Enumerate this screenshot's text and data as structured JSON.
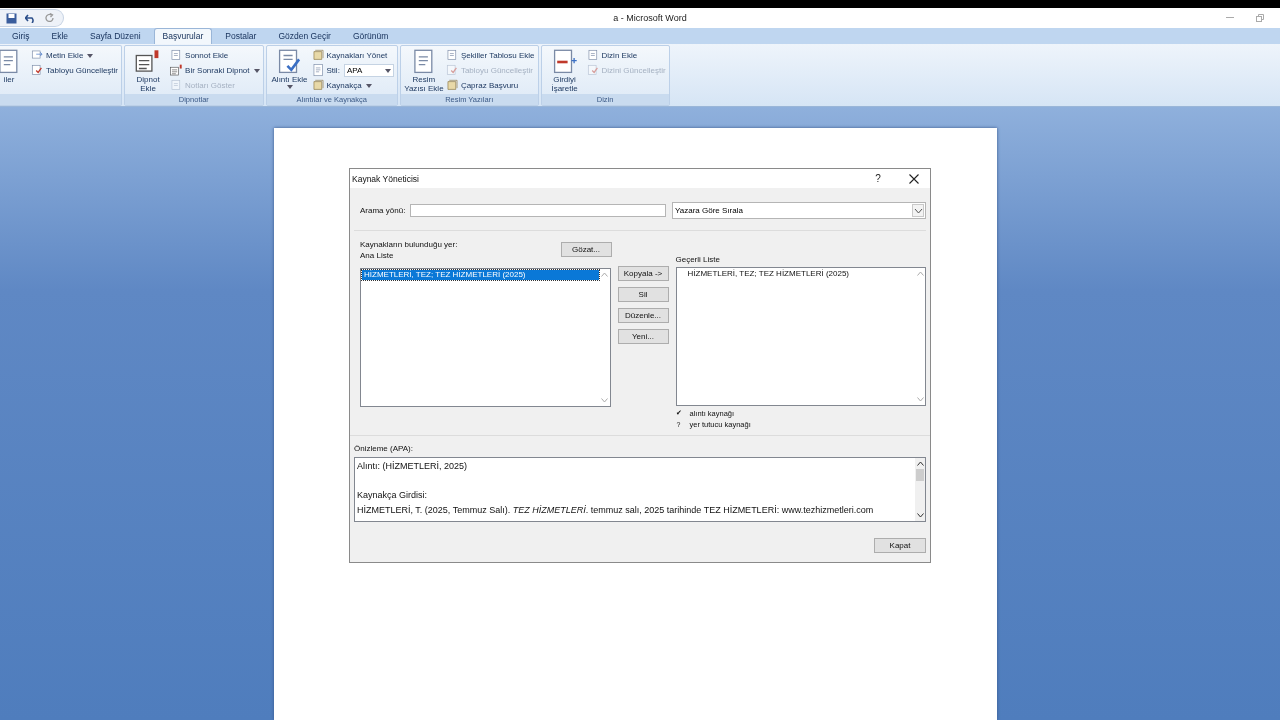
{
  "window": {
    "title": "a - Microsoft Word"
  },
  "tabs": [
    {
      "label": "Giriş",
      "selected": false
    },
    {
      "label": "Ekle",
      "selected": false
    },
    {
      "label": "Sayfa Düzeni",
      "selected": false
    },
    {
      "label": "Başvurular",
      "selected": true
    },
    {
      "label": "Postalar",
      "selected": false
    },
    {
      "label": "Gözden Geçir",
      "selected": false
    },
    {
      "label": "Görünüm",
      "selected": false
    }
  ],
  "ribbon_groups": [
    {
      "items": [
        {
          "kind": "large",
          "label": "iler",
          "dropdown": false,
          "disabled": false
        },
        {
          "kind": "small",
          "label": "Metin Ekle",
          "dropdown": true,
          "disabled": false
        },
        {
          "kind": "small",
          "label": "Tabloyu Güncelleştir",
          "dropdown": false,
          "disabled": false
        }
      ]
    },
    {
      "label": "Dipnotlar",
      "items": [
        {
          "kind": "large",
          "label": "Dipnot Ekle",
          "dropdown": false,
          "disabled": false
        },
        {
          "kind": "small",
          "label": "Sonnot Ekle",
          "dropdown": false,
          "disabled": false
        },
        {
          "kind": "small",
          "label": "Bir Sonraki Dipnot",
          "dropdown": true,
          "disabled": false
        },
        {
          "kind": "small",
          "label": "Notları Göster",
          "dropdown": false,
          "disabled": true
        }
      ]
    },
    {
      "label": "Alıntılar ve Kaynakça",
      "items": [
        {
          "kind": "large",
          "label": "Alıntı Ekle",
          "dropdown": true,
          "disabled": false
        },
        {
          "kind": "small",
          "label": "Kaynakları Yönet",
          "dropdown": false,
          "disabled": false
        },
        {
          "kind": "style",
          "label": "Stil:",
          "value": "APA",
          "dropdown": true,
          "disabled": false
        },
        {
          "kind": "small",
          "label": "Kaynakça",
          "dropdown": true,
          "disabled": false
        }
      ]
    },
    {
      "label": "Resim Yazıları",
      "items": [
        {
          "kind": "large",
          "label": "Resim Yazısı Ekle",
          "dropdown": false,
          "disabled": false
        },
        {
          "kind": "small",
          "label": "Şekiller Tablosu Ekle",
          "dropdown": false,
          "disabled": false
        },
        {
          "kind": "small",
          "label": "Tabloyu Güncelleştir",
          "dropdown": false,
          "disabled": true
        },
        {
          "kind": "small",
          "label": "Çapraz Başvuru",
          "dropdown": false,
          "disabled": false
        }
      ]
    },
    {
      "label": "Dizin",
      "items": [
        {
          "kind": "large",
          "label": "Girdiyi İşaretle",
          "dropdown": false,
          "disabled": false
        },
        {
          "kind": "small",
          "label": "Dizin Ekle",
          "dropdown": false,
          "disabled": false
        },
        {
          "kind": "small",
          "label": "Dizini Güncelleştir",
          "dropdown": false,
          "disabled": true
        }
      ]
    }
  ],
  "dialog": {
    "title": "Kaynak Yöneticisi",
    "help": "?",
    "search": {
      "label": "Arama yönü:"
    },
    "sort": {
      "value": "Yazara Göre Sırala"
    },
    "location_label": "Kaynakların bulunduğu yer:",
    "browse_button": "Gözat...",
    "master_list": {
      "label": "Ana Liste",
      "items": [
        {
          "text": "HİZMETLERİ, TEZ; TEZ HİZMETLERİ (2025)",
          "selected": true
        }
      ]
    },
    "actions": [
      "Kopyala ->",
      "Sil",
      "Düzenle...",
      "Yeni..."
    ],
    "current_list": {
      "label": "Geçerli Liste",
      "items": [
        {
          "text": "HİZMETLERİ, TEZ; TEZ HİZMETLERİ (2025)",
          "selected": false
        }
      ]
    },
    "legend": [
      {
        "symbol": "✔",
        "text": "alıntı kaynağı"
      },
      {
        "symbol": "?",
        "text": "yer tutucu kaynağı"
      }
    ],
    "preview": {
      "label": "Önizleme (APA):",
      "citation": "Alıntı: (HİZMETLERİ, 2025)",
      "bibliography_label": "Kaynakça Girdisi:",
      "bibliography": "HİZMETLERİ, T. (2025, Temmuz Salı). *TEZ HİZMETLERİ*. temmuz salı, 2025 tarihinde TEZ HİZMETLERİ: www.tezhizmetleri.com"
    },
    "close_button": "Kapat"
  }
}
